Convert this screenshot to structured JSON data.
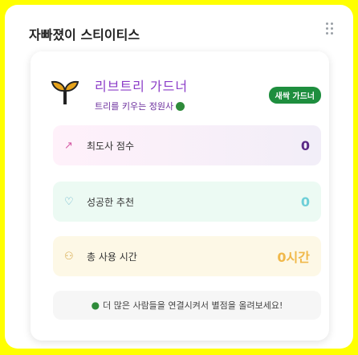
{
  "header": {
    "title": "자빠졌이 스티이티스"
  },
  "gardener": {
    "name": "리브트리 가드너",
    "subtitle": "트리를 키우는 정원사",
    "badge": "새싹 가드너"
  },
  "stats": [
    {
      "icon": "trending-up-icon",
      "label": "최도사 점수",
      "value": "0"
    },
    {
      "icon": "heart-icon",
      "label": "성공한 추천",
      "value": "0"
    },
    {
      "icon": "users-icon",
      "label": "총 사용 시간",
      "value": "0시간"
    }
  ],
  "note": {
    "text": "더 많은 사람들을 연결시켜서 별점을 올려보세요!"
  },
  "colors": {
    "page_bg": "#ffff00",
    "accent": "#8b3cc8",
    "badge": "#1e8e3e"
  }
}
